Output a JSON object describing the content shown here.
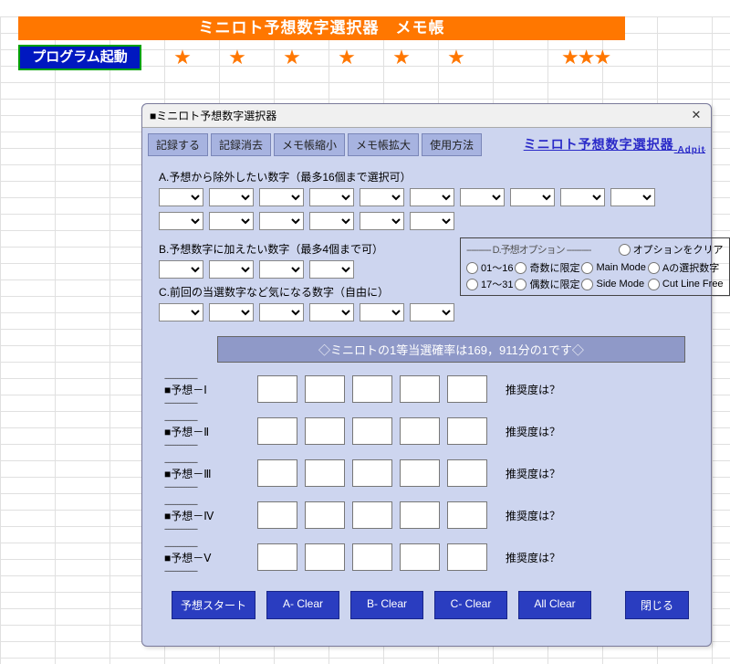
{
  "sheet_header": "ミニロト予想数字選択器　メモ帳",
  "launch_button": "プログラム起動",
  "stars": [
    "★",
    "★",
    "★",
    "★",
    "★",
    "★"
  ],
  "stars3": "★★★",
  "dialog": {
    "title": "■ミニロト予想数字選択器",
    "tabs": [
      "記録する",
      "記録消去",
      "メモ帳縮小",
      "メモ帳拡大",
      "使用方法"
    ],
    "brand": "ミニロト予想数字選択器",
    "brand_suffix": " Adpit",
    "sections": {
      "a_label": "A.予想から除外したい数字（最多16個まで選択可）",
      "b_label": "B.予想数字に加えたい数字（最多4個まで可）",
      "c_label": "C.前回の当選数字など気になる数字（自由に）"
    },
    "options": {
      "header_left": "---------- D.予想オプション ----------",
      "header_right": "オプションをクリア",
      "rows": [
        [
          "01～16",
          "奇数に限定",
          "Main Mode",
          "Aの選択数字"
        ],
        [
          "17～31",
          "偶数に限定",
          "Side Mode",
          "Cut Line Free"
        ]
      ]
    },
    "prob_banner": "◇ミニロトの1等当選確率は169，911分の1です◇",
    "predictions": {
      "labels": [
        "■予想－Ⅰ",
        "■予想－Ⅱ",
        "■予想－Ⅲ",
        "■予想－Ⅳ",
        "■予想－Ⅴ"
      ],
      "recommend": "推奨度は？"
    },
    "buttons": {
      "start": "予想スタート",
      "a_clear": "A- Clear",
      "b_clear": "B- Clear",
      "c_clear": "C- Clear",
      "all_clear": "All Clear",
      "close": "閉じる"
    }
  }
}
